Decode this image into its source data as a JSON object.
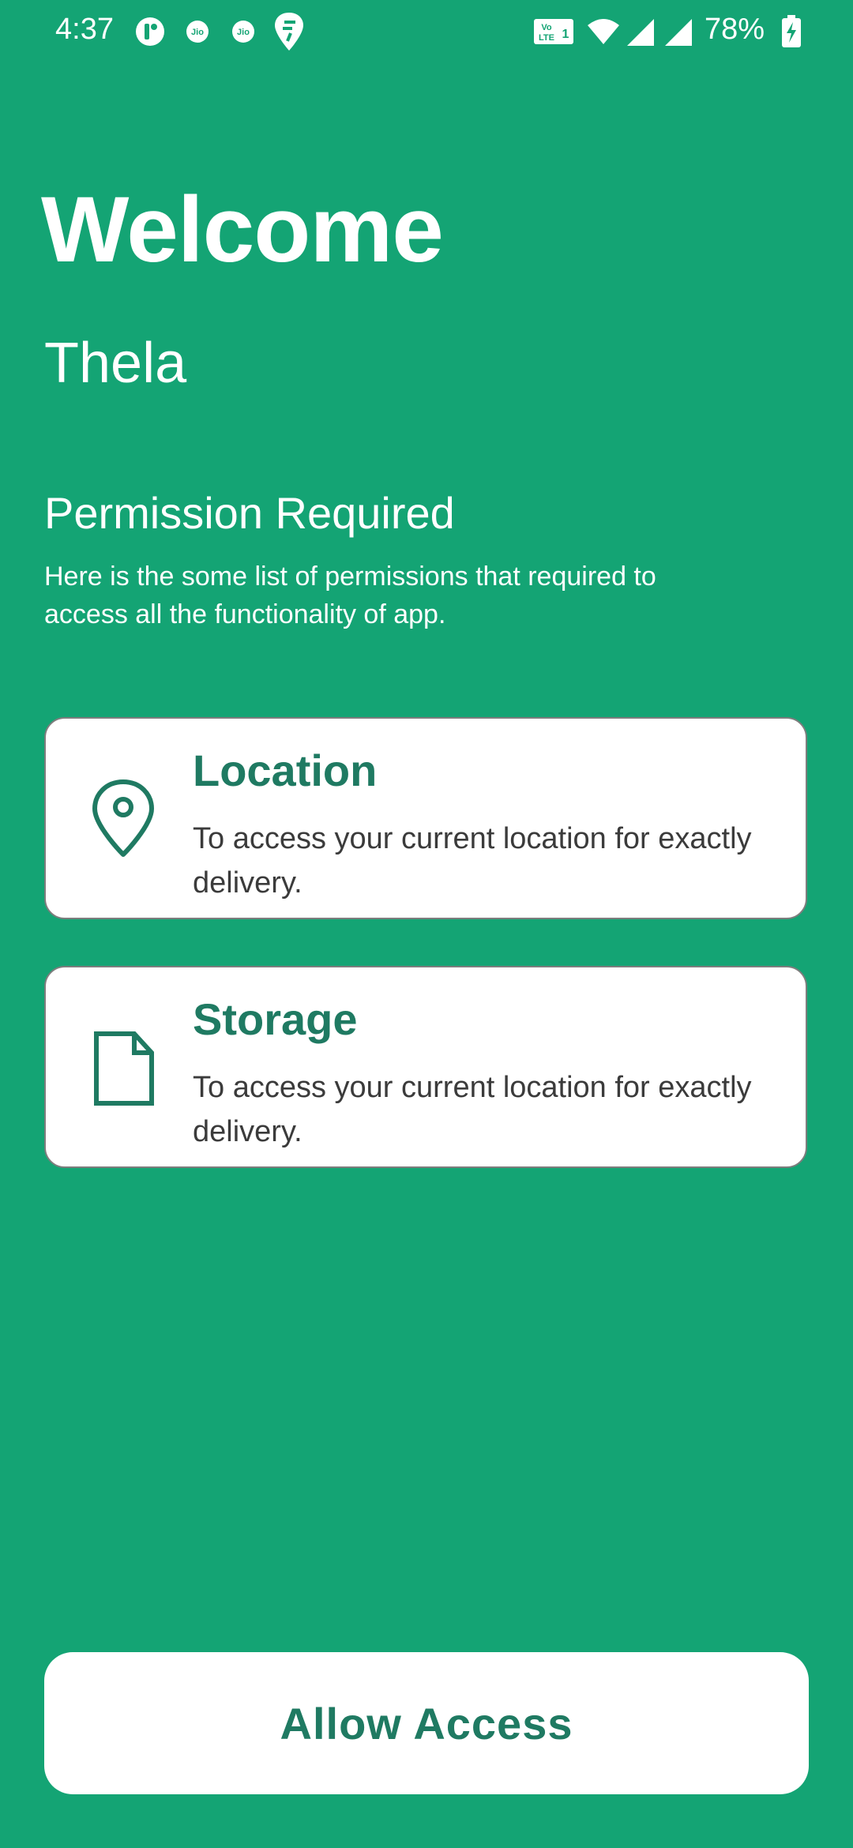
{
  "status_bar": {
    "time": "4:37",
    "battery": "78%",
    "icons": [
      "app-badge-icon",
      "jio-icon",
      "jio-icon",
      "swiggy-icon",
      "volte-icon",
      "wifi-icon",
      "signal-icon",
      "signal-icon",
      "battery-icon"
    ]
  },
  "header": {
    "welcome": "Welcome",
    "app_name": "Thela"
  },
  "permission_section": {
    "title": "Permission Required",
    "description": "Here is the some list of permissions that required to access all the functionality of app."
  },
  "permissions": [
    {
      "icon": "location-pin-icon",
      "title": "Location",
      "description": "To access your current location for exactly delivery."
    },
    {
      "icon": "document-icon",
      "title": "Storage",
      "description": "To access your current location for exactly delivery."
    }
  ],
  "actions": {
    "allow_label": "Allow Access"
  },
  "colors": {
    "background": "#14a474",
    "accent_text": "#1f7a62",
    "card_bg": "#ffffff"
  }
}
